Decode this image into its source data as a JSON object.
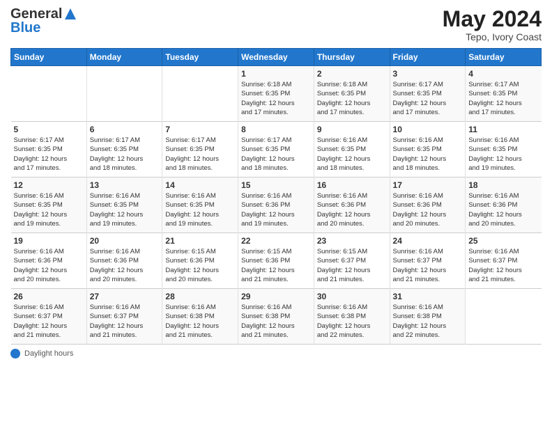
{
  "header": {
    "logo_general": "General",
    "logo_blue": "Blue",
    "month_year": "May 2024",
    "location": "Tepo, Ivory Coast"
  },
  "footer": {
    "daylight_label": "Daylight hours"
  },
  "days_of_week": [
    "Sunday",
    "Monday",
    "Tuesday",
    "Wednesday",
    "Thursday",
    "Friday",
    "Saturday"
  ],
  "weeks": [
    [
      {
        "day": "",
        "info": ""
      },
      {
        "day": "",
        "info": ""
      },
      {
        "day": "",
        "info": ""
      },
      {
        "day": "1",
        "info": "Sunrise: 6:18 AM\nSunset: 6:35 PM\nDaylight: 12 hours\nand 17 minutes."
      },
      {
        "day": "2",
        "info": "Sunrise: 6:18 AM\nSunset: 6:35 PM\nDaylight: 12 hours\nand 17 minutes."
      },
      {
        "day": "3",
        "info": "Sunrise: 6:17 AM\nSunset: 6:35 PM\nDaylight: 12 hours\nand 17 minutes."
      },
      {
        "day": "4",
        "info": "Sunrise: 6:17 AM\nSunset: 6:35 PM\nDaylight: 12 hours\nand 17 minutes."
      }
    ],
    [
      {
        "day": "5",
        "info": "Sunrise: 6:17 AM\nSunset: 6:35 PM\nDaylight: 12 hours\nand 17 minutes."
      },
      {
        "day": "6",
        "info": "Sunrise: 6:17 AM\nSunset: 6:35 PM\nDaylight: 12 hours\nand 18 minutes."
      },
      {
        "day": "7",
        "info": "Sunrise: 6:17 AM\nSunset: 6:35 PM\nDaylight: 12 hours\nand 18 minutes."
      },
      {
        "day": "8",
        "info": "Sunrise: 6:17 AM\nSunset: 6:35 PM\nDaylight: 12 hours\nand 18 minutes."
      },
      {
        "day": "9",
        "info": "Sunrise: 6:16 AM\nSunset: 6:35 PM\nDaylight: 12 hours\nand 18 minutes."
      },
      {
        "day": "10",
        "info": "Sunrise: 6:16 AM\nSunset: 6:35 PM\nDaylight: 12 hours\nand 18 minutes."
      },
      {
        "day": "11",
        "info": "Sunrise: 6:16 AM\nSunset: 6:35 PM\nDaylight: 12 hours\nand 19 minutes."
      }
    ],
    [
      {
        "day": "12",
        "info": "Sunrise: 6:16 AM\nSunset: 6:35 PM\nDaylight: 12 hours\nand 19 minutes."
      },
      {
        "day": "13",
        "info": "Sunrise: 6:16 AM\nSunset: 6:35 PM\nDaylight: 12 hours\nand 19 minutes."
      },
      {
        "day": "14",
        "info": "Sunrise: 6:16 AM\nSunset: 6:35 PM\nDaylight: 12 hours\nand 19 minutes."
      },
      {
        "day": "15",
        "info": "Sunrise: 6:16 AM\nSunset: 6:36 PM\nDaylight: 12 hours\nand 19 minutes."
      },
      {
        "day": "16",
        "info": "Sunrise: 6:16 AM\nSunset: 6:36 PM\nDaylight: 12 hours\nand 20 minutes."
      },
      {
        "day": "17",
        "info": "Sunrise: 6:16 AM\nSunset: 6:36 PM\nDaylight: 12 hours\nand 20 minutes."
      },
      {
        "day": "18",
        "info": "Sunrise: 6:16 AM\nSunset: 6:36 PM\nDaylight: 12 hours\nand 20 minutes."
      }
    ],
    [
      {
        "day": "19",
        "info": "Sunrise: 6:16 AM\nSunset: 6:36 PM\nDaylight: 12 hours\nand 20 minutes."
      },
      {
        "day": "20",
        "info": "Sunrise: 6:16 AM\nSunset: 6:36 PM\nDaylight: 12 hours\nand 20 minutes."
      },
      {
        "day": "21",
        "info": "Sunrise: 6:15 AM\nSunset: 6:36 PM\nDaylight: 12 hours\nand 20 minutes."
      },
      {
        "day": "22",
        "info": "Sunrise: 6:15 AM\nSunset: 6:36 PM\nDaylight: 12 hours\nand 21 minutes."
      },
      {
        "day": "23",
        "info": "Sunrise: 6:15 AM\nSunset: 6:37 PM\nDaylight: 12 hours\nand 21 minutes."
      },
      {
        "day": "24",
        "info": "Sunrise: 6:16 AM\nSunset: 6:37 PM\nDaylight: 12 hours\nand 21 minutes."
      },
      {
        "day": "25",
        "info": "Sunrise: 6:16 AM\nSunset: 6:37 PM\nDaylight: 12 hours\nand 21 minutes."
      }
    ],
    [
      {
        "day": "26",
        "info": "Sunrise: 6:16 AM\nSunset: 6:37 PM\nDaylight: 12 hours\nand 21 minutes."
      },
      {
        "day": "27",
        "info": "Sunrise: 6:16 AM\nSunset: 6:37 PM\nDaylight: 12 hours\nand 21 minutes."
      },
      {
        "day": "28",
        "info": "Sunrise: 6:16 AM\nSunset: 6:38 PM\nDaylight: 12 hours\nand 21 minutes."
      },
      {
        "day": "29",
        "info": "Sunrise: 6:16 AM\nSunset: 6:38 PM\nDaylight: 12 hours\nand 21 minutes."
      },
      {
        "day": "30",
        "info": "Sunrise: 6:16 AM\nSunset: 6:38 PM\nDaylight: 12 hours\nand 22 minutes."
      },
      {
        "day": "31",
        "info": "Sunrise: 6:16 AM\nSunset: 6:38 PM\nDaylight: 12 hours\nand 22 minutes."
      },
      {
        "day": "",
        "info": ""
      }
    ]
  ]
}
